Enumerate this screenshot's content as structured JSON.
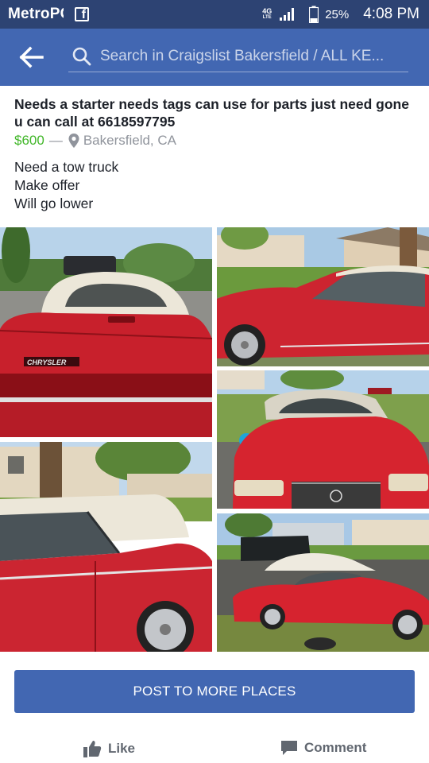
{
  "status_bar": {
    "carrier": "MetroPCS",
    "network_type": "4G",
    "network_sub": "LTE",
    "battery": "25%",
    "time": "4:08 PM"
  },
  "header": {
    "search_placeholder": "Search in Craigslist Bakersfield / ALL KE..."
  },
  "post": {
    "title": "Needs a starter needs tags can use for parts just need gone u can call at 6618597795",
    "price": "$600",
    "separator": "—",
    "location": "Bakersfield, CA",
    "description": [
      "Need a tow truck",
      "Make offer",
      "Will go lower"
    ]
  },
  "photos": [
    {
      "icon": "car-rear-photo",
      "badge": "CHRYSLER"
    },
    {
      "icon": "car-side-photo"
    },
    {
      "icon": "car-front-photo"
    },
    {
      "icon": "car-side-closeup-photo"
    },
    {
      "icon": "car-full-side-photo"
    }
  ],
  "actions": {
    "post_to_more": "POST TO MORE PLACES",
    "like": "Like",
    "comment": "Comment"
  },
  "colors": {
    "status_bar": "#2d4373",
    "header": "#4267b2",
    "price": "#42b72a",
    "secondary_text": "#90949c",
    "car_red": "#d42a34"
  }
}
